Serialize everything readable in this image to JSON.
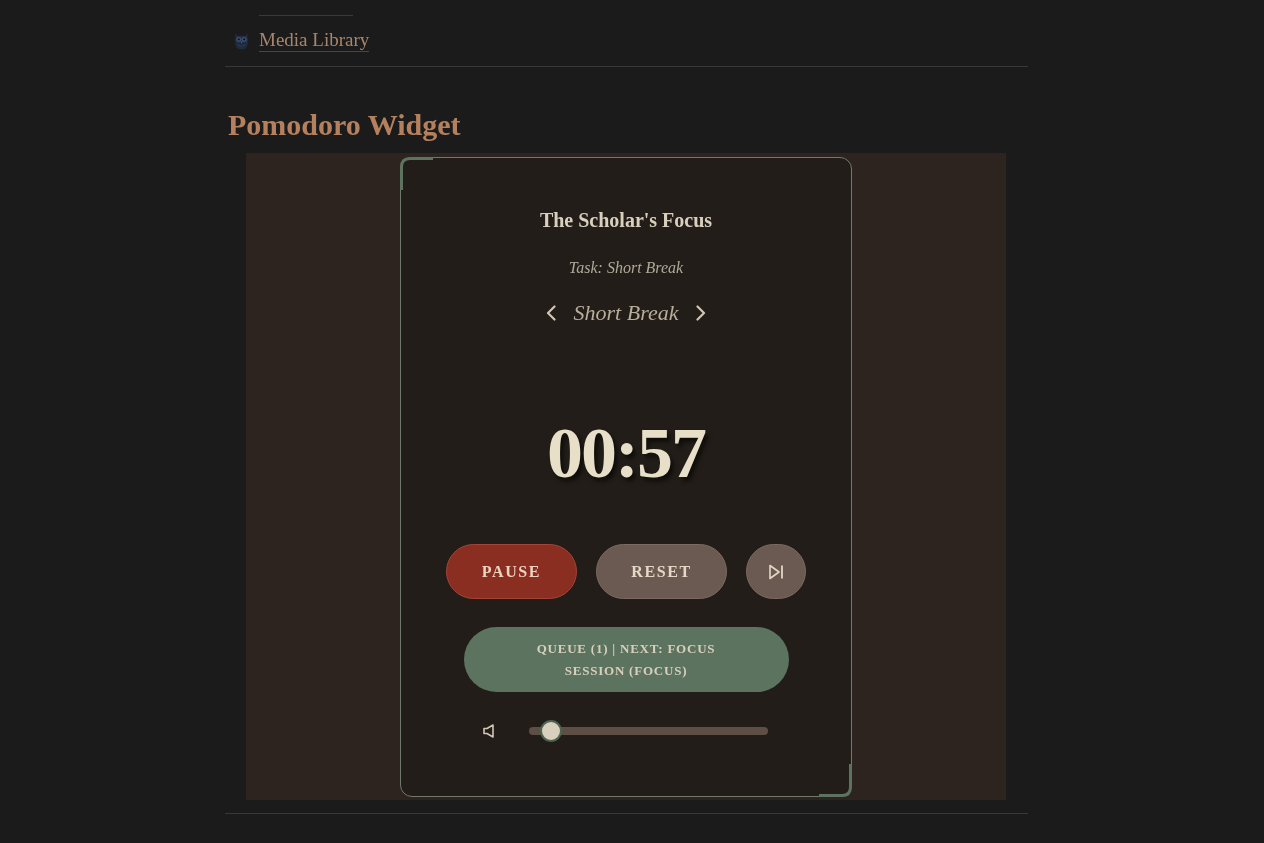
{
  "nav": {
    "link": "Media Library"
  },
  "heading": "Pomodoro Widget",
  "widget": {
    "title": "The Scholar's Focus",
    "task": "Task: Short Break",
    "mode": "Short Break",
    "timer": "00:57",
    "buttons": [
      {
        "kind": "pause",
        "label": "PAUSE"
      },
      {
        "kind": "reset",
        "label": "RESET"
      },
      {
        "kind": "skip"
      }
    ],
    "queue_button": "QUEUE (1) | NEXT: FOCUS SESSION (FOCUS)",
    "volume": {
      "level": 0.05
    }
  }
}
